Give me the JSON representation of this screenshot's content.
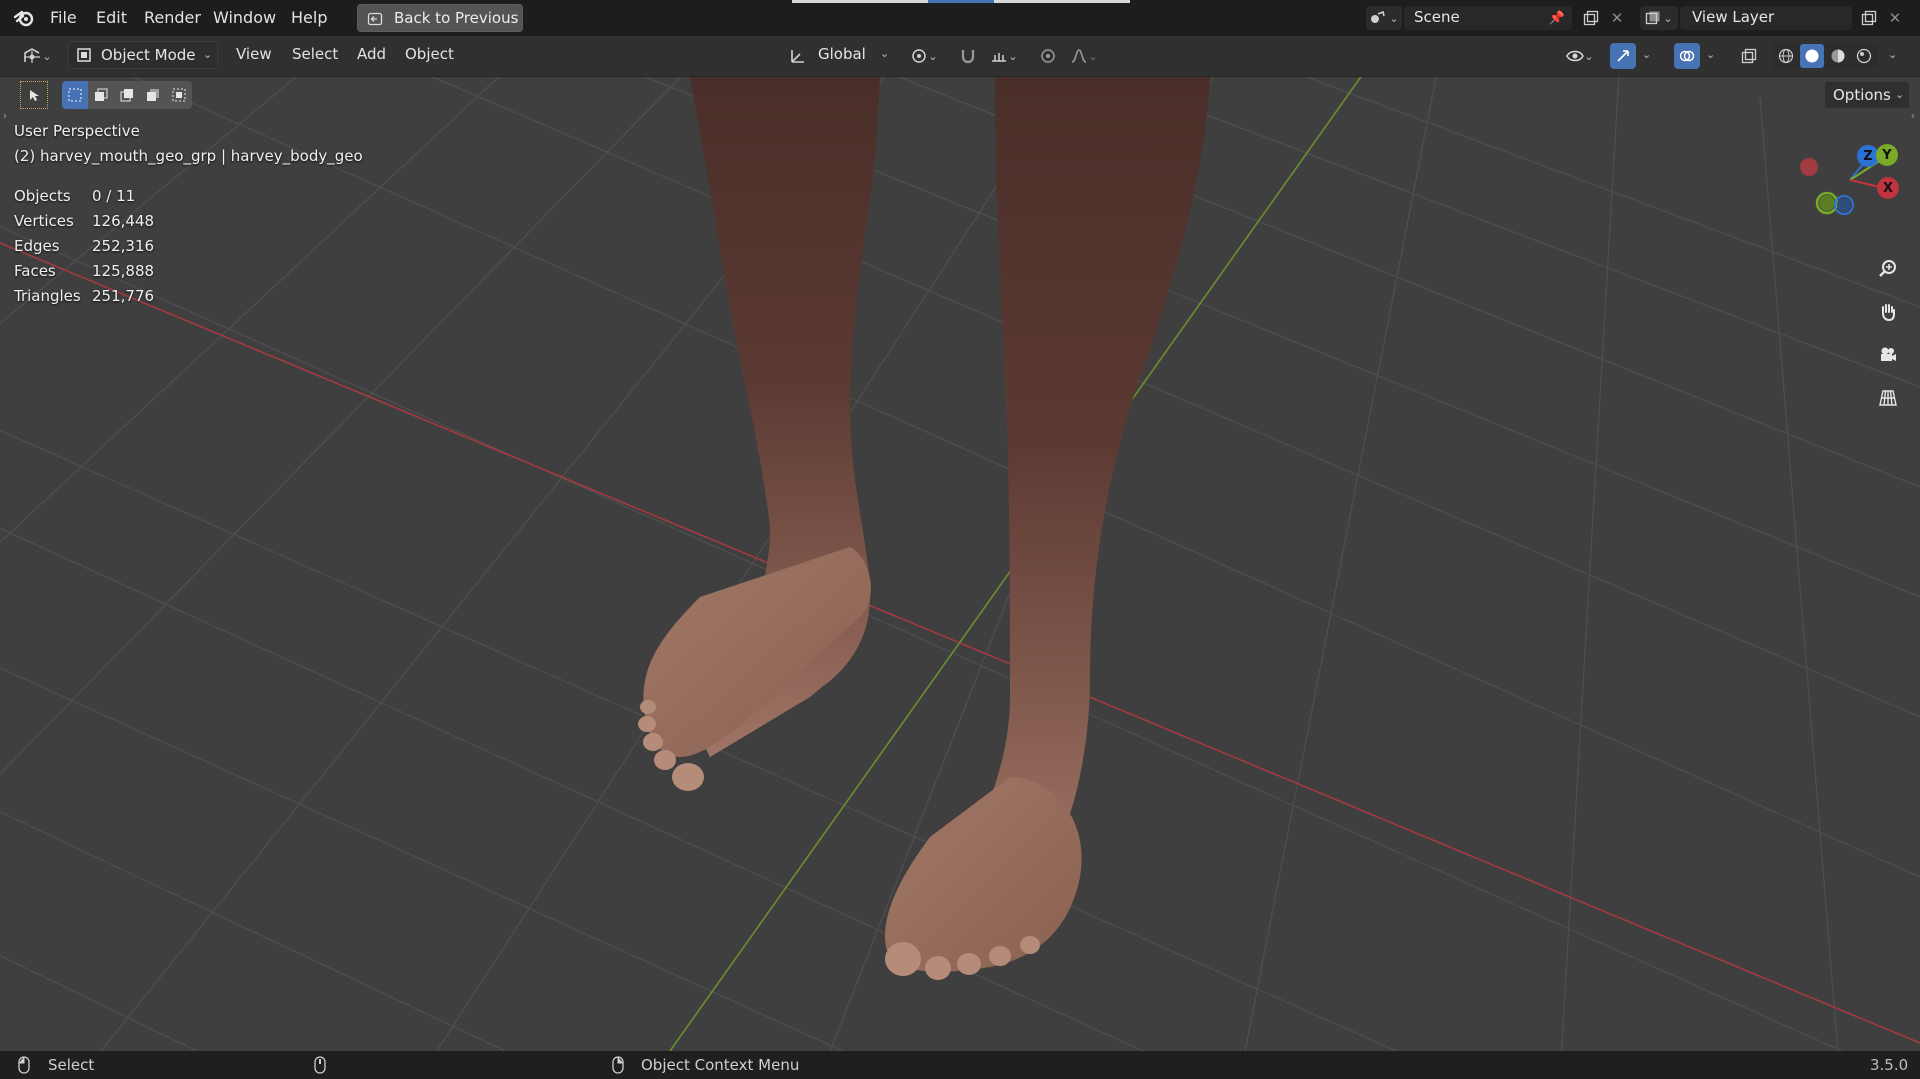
{
  "menu": {
    "file": "File",
    "edit": "Edit",
    "render": "Render",
    "window": "Window",
    "help": "Help"
  },
  "back_button": "Back to Previous",
  "scene": {
    "name": "Scene"
  },
  "view_layer": {
    "name": "View Layer"
  },
  "header": {
    "mode": "Object Mode",
    "view": "View",
    "select": "Select",
    "add": "Add",
    "object": "Object",
    "transform_orientation": "Global"
  },
  "options_label": "Options",
  "viewport_info": {
    "perspective": "User Perspective",
    "collection": "(2) harvey_mouth_geo_grp | harvey_body_geo",
    "stats": [
      {
        "label": "Objects",
        "value": "0 / 11"
      },
      {
        "label": "Vertices",
        "value": "126,448"
      },
      {
        "label": "Edges",
        "value": "252,316"
      },
      {
        "label": "Faces",
        "value": "125,888"
      },
      {
        "label": "Triangles",
        "value": "251,776"
      }
    ]
  },
  "gizmo": {
    "z": "Z",
    "y": "Y",
    "x": "X"
  },
  "colors": {
    "x_axis": "#c1333f",
    "y_axis": "#7aaa28",
    "z_axis": "#2a72d6",
    "accent": "#4772b3"
  },
  "status": {
    "select": "Select",
    "context_menu": "Object Context Menu",
    "version": "3.5.0"
  }
}
